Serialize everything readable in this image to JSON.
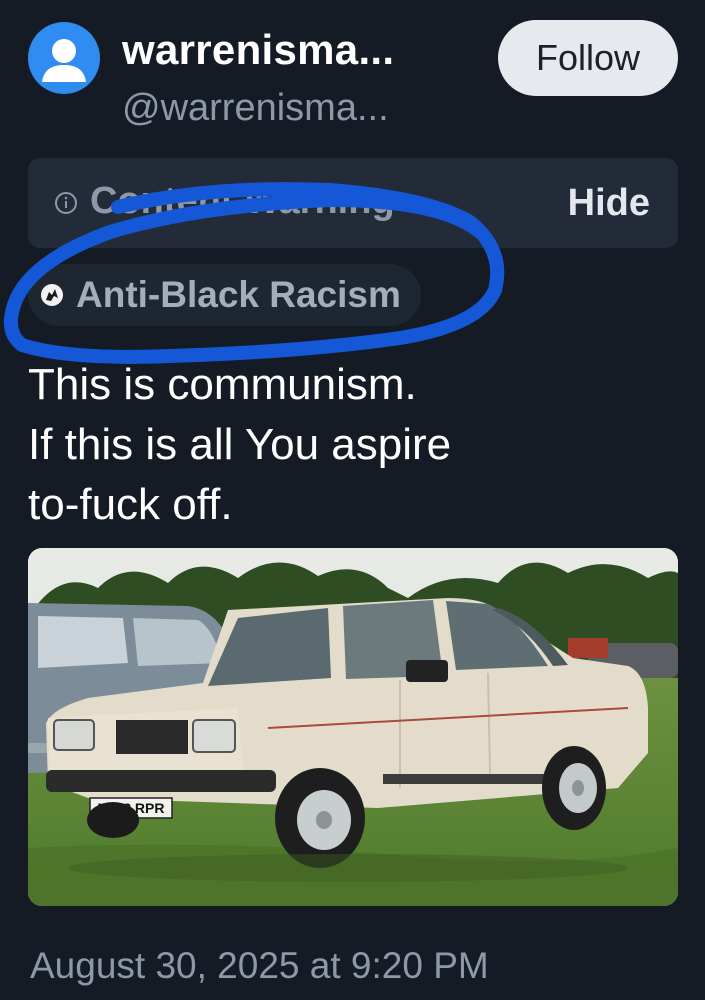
{
  "author": {
    "display_name": "warrenisma...",
    "handle": "@warrenisma...",
    "avatar_icon": "default-user-avatar-icon"
  },
  "follow_label": "Follow",
  "content_warning": {
    "label": "Content Warning",
    "hide_label": "Hide",
    "icon": "info-icon"
  },
  "tag": {
    "label": "Anti-Black Racism",
    "icon": "tag-emblem-icon"
  },
  "post_lines": [
    "This is communism.",
    "If this is all You aspire",
    "to-fuck off."
  ],
  "media": {
    "plate_text": "N948 RPR"
  },
  "timestamp": "August 30, 2025 at 9:20 PM",
  "colors": {
    "background": "#151b24",
    "annotation_loop": "#1458d8",
    "avatar": "#2f8cf0"
  }
}
